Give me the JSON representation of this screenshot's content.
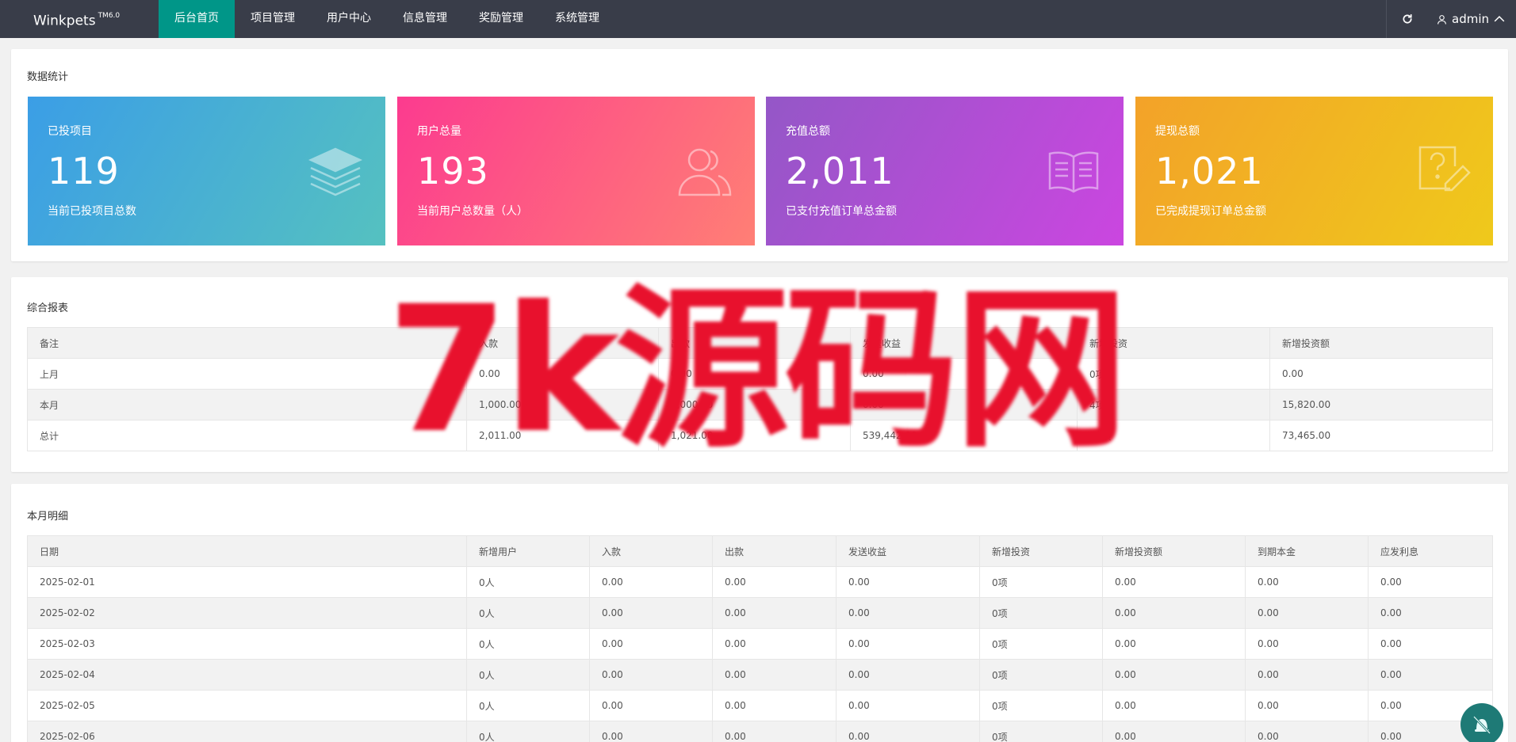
{
  "header": {
    "logo": "Winkpets",
    "logo_version": "TM6.0",
    "nav": [
      {
        "label": "后台首页",
        "active": true
      },
      {
        "label": "项目管理"
      },
      {
        "label": "用户中心"
      },
      {
        "label": "信息管理"
      },
      {
        "label": "奖励管理"
      },
      {
        "label": "系统管理"
      }
    ],
    "user": "admin",
    "icons": {
      "refresh": "refresh-icon",
      "user": "user-icon",
      "caret": "chevron-up-icon"
    }
  },
  "stats": {
    "title": "数据统计",
    "cards": [
      {
        "title": "已投项目",
        "value": "119",
        "desc": "当前已投项目总数",
        "icon": "layers-icon",
        "color_from": "#3b9ee6",
        "color_to": "#55c1c0"
      },
      {
        "title": "用户总量",
        "value": "193",
        "desc": "当前用户总数量（人）",
        "icon": "users-icon",
        "color_from": "#fc3b8f",
        "color_to": "#ff7f75"
      },
      {
        "title": "充值总额",
        "value": "2,011",
        "desc": "已支付充值订单总金额",
        "icon": "book-icon",
        "color_from": "#9457c7",
        "color_to": "#cb46e0"
      },
      {
        "title": "提现总额",
        "value": "1,021",
        "desc": "已完成提现订单总金额",
        "icon": "edit-icon",
        "color_from": "#f3a229",
        "color_to": "#efc91b"
      }
    ]
  },
  "report": {
    "title": "综合报表",
    "headers": [
      "备注",
      "入款",
      "出款",
      "发送收益",
      "新增投资",
      "新增投资额"
    ],
    "rows": [
      [
        "上月",
        "0.00",
        "0.00",
        "0.00",
        "0项",
        "0.00"
      ],
      [
        "本月",
        "1,000.00",
        "1,000.00",
        "0.00",
        "4项",
        "15,820.00"
      ],
      [
        "总计",
        "2,011.00",
        "1,021.00",
        "539,442.00",
        "11项",
        "73,465.00"
      ]
    ]
  },
  "detail": {
    "title": "本月明细",
    "headers": [
      "日期",
      "新增用户",
      "入款",
      "出款",
      "发送收益",
      "新增投资",
      "新增投资额",
      "到期本金",
      "应发利息"
    ],
    "rows": [
      [
        "2025-02-01",
        "0人",
        "0.00",
        "0.00",
        "0.00",
        "0项",
        "0.00",
        "0.00",
        "0.00"
      ],
      [
        "2025-02-02",
        "0人",
        "0.00",
        "0.00",
        "0.00",
        "0项",
        "0.00",
        "0.00",
        "0.00"
      ],
      [
        "2025-02-03",
        "0人",
        "0.00",
        "0.00",
        "0.00",
        "0项",
        "0.00",
        "0.00",
        "0.00"
      ],
      [
        "2025-02-04",
        "0人",
        "0.00",
        "0.00",
        "0.00",
        "0项",
        "0.00",
        "0.00",
        "0.00"
      ],
      [
        "2025-02-05",
        "0人",
        "0.00",
        "0.00",
        "0.00",
        "0项",
        "0.00",
        "0.00",
        "0.00"
      ],
      [
        "2025-02-06",
        "0人",
        "0.00",
        "0.00",
        "0.00",
        "0项",
        "0.00",
        "0.00",
        "0.00"
      ]
    ]
  },
  "watermark": "7k源码网",
  "float_button": {
    "icon": "bell-off-icon"
  }
}
